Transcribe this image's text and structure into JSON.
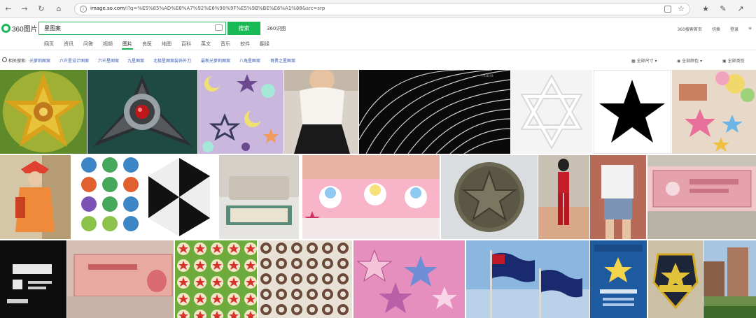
{
  "browser": {
    "url_host": "image.so.com",
    "url_rest": "/i?q=%E5%85%AD%E8%A7%92%E6%98%9F%E5%9B%BE%E6%A1%88&src=srp",
    "icons": [
      "back-icon",
      "forward-icon",
      "reload-icon",
      "home-icon",
      "info-icon",
      "reader-icon",
      "bookmark-star-icon",
      "favorites-icon",
      "collections-icon",
      "share-icon"
    ]
  },
  "header": {
    "logo_text": "360图片",
    "query": "星图案",
    "search_button": "搜索",
    "index_link": "360识图",
    "right_links": [
      "360搜索首页",
      "切换",
      "登录",
      "≡"
    ]
  },
  "tabs": {
    "items": [
      "网页",
      "资讯",
      "问答",
      "视频",
      "图片",
      "良医",
      "地图",
      "百科",
      "英文",
      "音乐",
      "软件",
      "翻译"
    ],
    "active": "图片"
  },
  "related": {
    "label": "相关搜索:",
    "items": [
      "光萝莉图案",
      "六芒星设计图案",
      "六芒星图案",
      "九星图案",
      "北极星图案装饰外刀",
      "最新光萝莉图案",
      "八角星图案",
      "哥勇之星图案"
    ],
    "filters": [
      "全部尺寸",
      "全部颜色",
      "全部类别"
    ]
  },
  "thumbnails": {
    "row1": [
      "kaleidoscope star pattern",
      "metal star emblem",
      "moon and star wallpaper",
      "white blouse photo",
      "light streaks",
      "hexagram outline",
      "black star",
      "crafts with stars"
    ],
    "row2": [
      "woman orange coat",
      "star seal icons",
      "black white hexagram",
      "sofa with rug",
      "pink fabric cartoon",
      "bronze coin",
      "girl red outfit",
      "girl jeans shorts",
      "banknote pink"
    ],
    "row3": [
      "black shop card",
      "banknote red",
      "red star pattern",
      "star lattice pattern",
      "pink star fabric",
      "flags on sky",
      "blue police poster",
      "sheriff badge",
      "city building"
    ]
  },
  "colors": {
    "accent": "#19b955",
    "link": "#3a5ab4"
  }
}
